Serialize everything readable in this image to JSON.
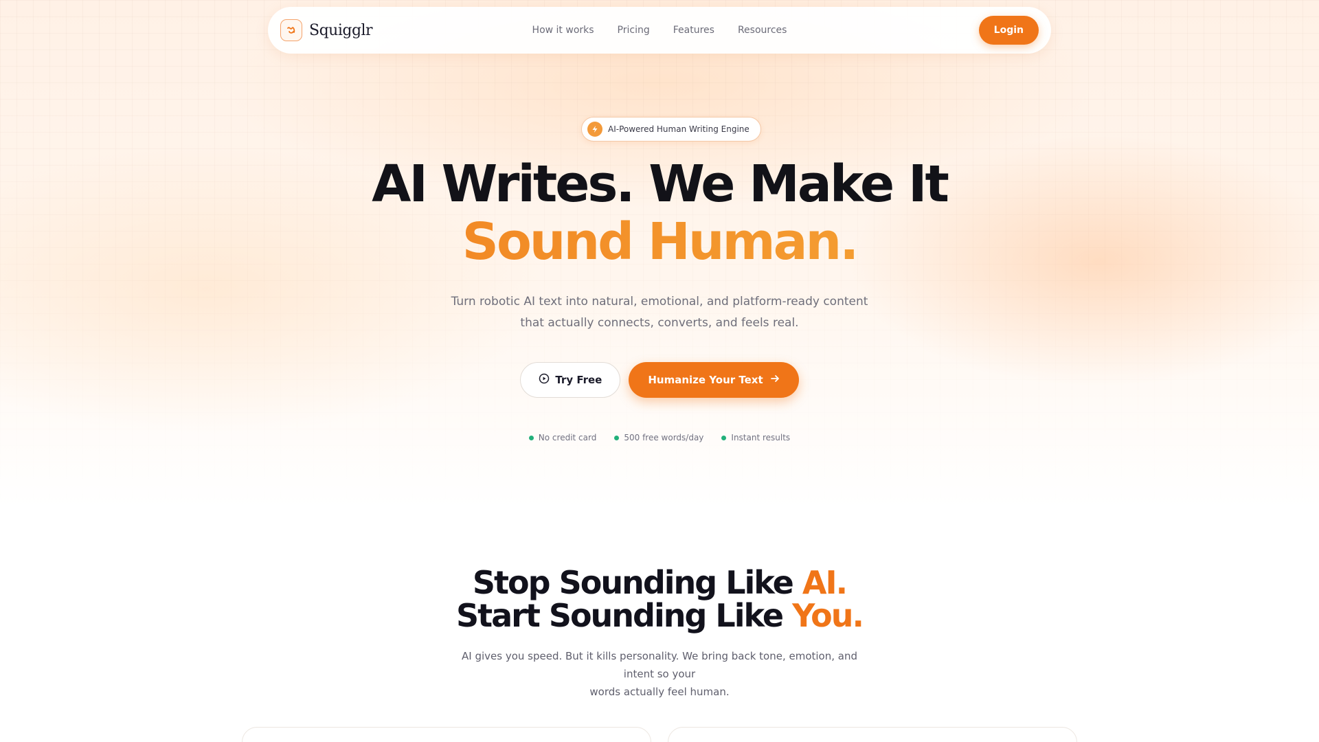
{
  "nav": {
    "brand": "Squigglr",
    "links": [
      "How it works",
      "Pricing",
      "Features",
      "Resources"
    ],
    "login": "Login"
  },
  "hero": {
    "badge": "AI-Powered Human Writing Engine",
    "title_line1": "AI Writes. We Make It",
    "title_line2": "Sound Human.",
    "subtitle_line1": "Turn robotic AI text into natural, emotional, and platform-ready content",
    "subtitle_line2": "that actually connects, converts, and feels real.",
    "try_free": "Try Free",
    "humanize": "Humanize Your Text",
    "perks": [
      "No credit card",
      "500 free words/day",
      "Instant results"
    ]
  },
  "section": {
    "title_a": "Stop Sounding Like ",
    "title_a_accent": "AI.",
    "title_b": "Start Sounding Like ",
    "title_b_accent": "You.",
    "subtitle_line1": "AI gives you speed. But it kills personality. We bring back tone, emotion, and intent so your",
    "subtitle_line2": "words actually feel human."
  },
  "colors": {
    "accent": "#f07518",
    "accent_light": "#f6b13e",
    "success": "#22b07a"
  },
  "icons": {
    "logo": "squiggle-logo-icon",
    "badge": "lightning-icon",
    "try_free": "play-circle-icon",
    "humanize": "arrow-right-icon"
  }
}
